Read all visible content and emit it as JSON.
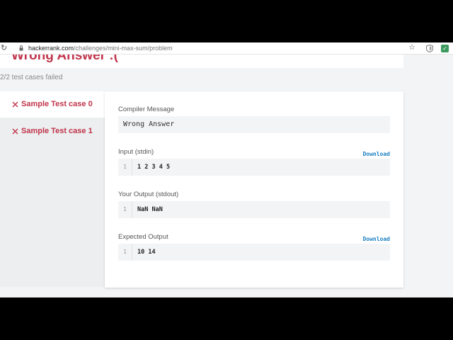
{
  "browser": {
    "url_host": "hackerrank.com",
    "url_path": "/challenges/mini-max-sum/problem",
    "reload_icon": "reload-icon",
    "lock_icon": "lock-icon",
    "star_icon": "bookmark-star-icon",
    "extension_icons": [
      "shield-extension-icon",
      "green-extension-icon"
    ]
  },
  "result": {
    "verdict": "Wrong Answer :(",
    "summary": "2/2 test cases failed"
  },
  "tabs": [
    {
      "label": "Sample Test case 0",
      "status": "failed",
      "icon": "x-icon"
    },
    {
      "label": "Sample Test case 1",
      "status": "failed",
      "icon": "x-icon"
    }
  ],
  "panel": {
    "compiler_message": {
      "label": "Compiler Message",
      "value": "Wrong Answer"
    },
    "input": {
      "label": "Input (stdin)",
      "download": "Download",
      "line": "1",
      "value": "1 2 3 4 5"
    },
    "your_output": {
      "label": "Your Output (stdout)",
      "line": "1",
      "value": "NaN NaN"
    },
    "expected_output": {
      "label": "Expected Output",
      "download": "Download",
      "line": "1",
      "value": "10 14"
    }
  },
  "colors": {
    "error_red": "#c1344b",
    "link_blue": "#1b7fc1",
    "code_bg": "#f3f4f5"
  }
}
